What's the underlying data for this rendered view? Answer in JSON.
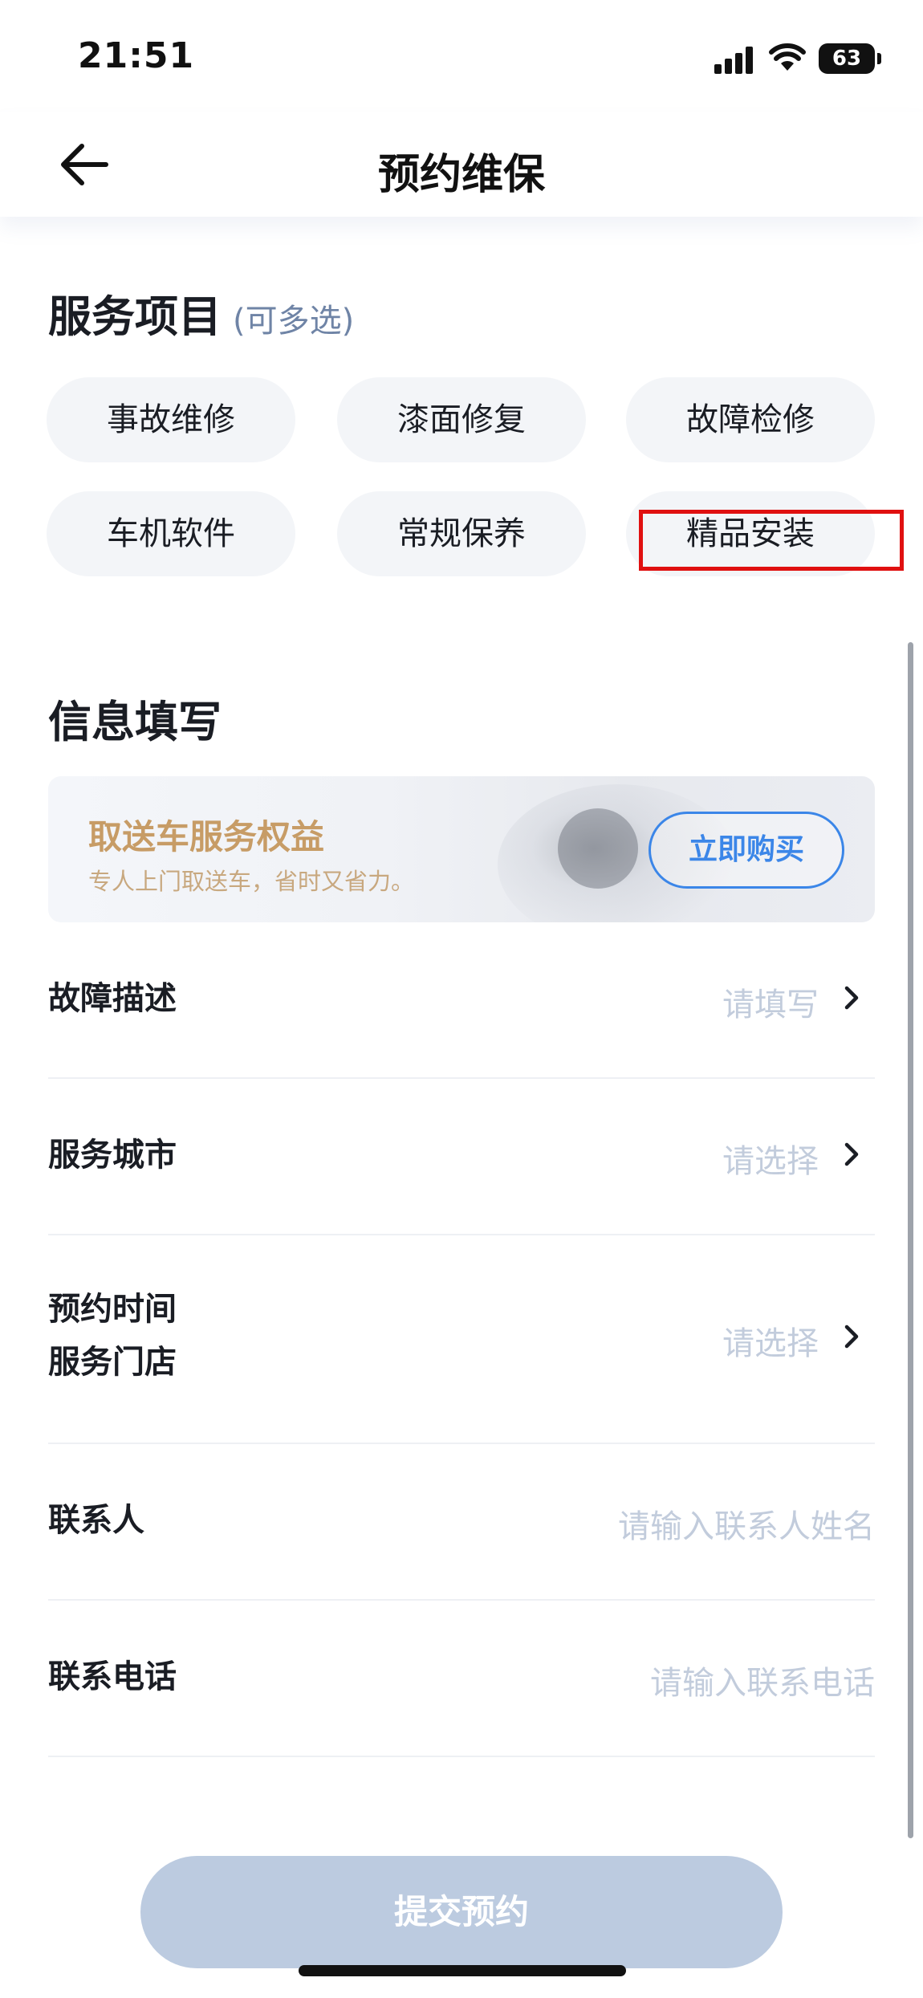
{
  "status_bar": {
    "time": "21:51",
    "battery": "63"
  },
  "nav": {
    "title": "预约维保"
  },
  "services": {
    "title": "服务项目",
    "hint": "(可多选)",
    "items": [
      "事故维修",
      "漆面修复",
      "故障检修",
      "车机软件",
      "常规保养",
      "精品安装"
    ],
    "highlighted": "精品安装"
  },
  "info": {
    "title": "信息填写",
    "banner": {
      "title": "取送车服务权益",
      "subtitle": "专人上门取送车，省时又省力。",
      "button": "立即购买"
    },
    "rows": [
      {
        "label": "故障描述",
        "value": "请填写"
      },
      {
        "label": "服务城市",
        "value": "请选择"
      },
      {
        "label_line1": "预约时间",
        "label_line2": "服务门店",
        "value": "请选择"
      },
      {
        "label": "联系人",
        "placeholder": "请输入联系人姓名"
      },
      {
        "label": "联系电话",
        "placeholder": "请输入联系电话"
      }
    ]
  },
  "submit": {
    "label": "提交预约"
  },
  "colors": {
    "accent": "#3b86e8",
    "highlight_border": "#e01010",
    "submit_disabled": "#bccbe0"
  }
}
